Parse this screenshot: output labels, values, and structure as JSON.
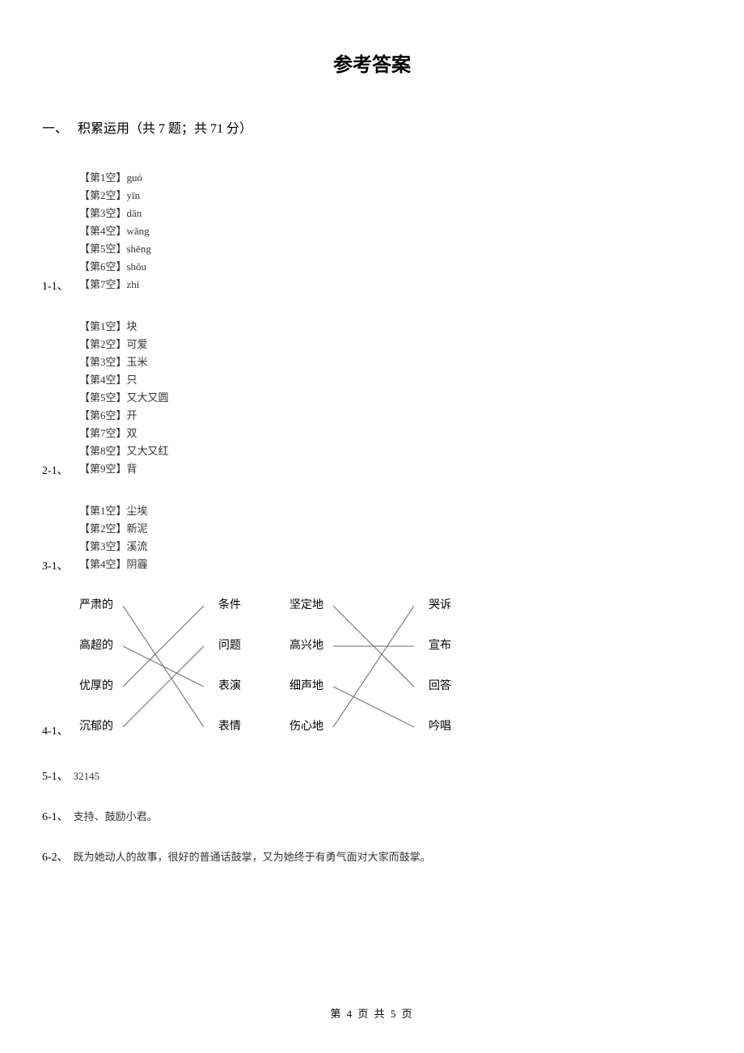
{
  "title": "参考答案",
  "section": {
    "prefix": "一、",
    "label": "积累运用（共 7 题；共 71 分）"
  },
  "q1": {
    "num": "1-1、",
    "items": [
      "【第1空】guó",
      "【第2空】yīn",
      "【第3空】dān",
      "【第4空】wǎng",
      "【第5空】shēng",
      "【第6空】shǒu",
      "【第7空】zhí"
    ]
  },
  "q2": {
    "num": "2-1、",
    "items": [
      "【第1空】块",
      "【第2空】可爱",
      "【第3空】玉米",
      "【第4空】只",
      "【第5空】又大又圆",
      "【第6空】开",
      "【第7空】双",
      "【第8空】又大又红",
      "【第9空】背"
    ]
  },
  "q3": {
    "num": "3-1、",
    "items": [
      "【第1空】尘埃",
      "【第2空】新泥",
      "【第3空】溪流",
      "【第4空】阴霾"
    ]
  },
  "q4": {
    "num": "4-1、",
    "groupA": {
      "left": [
        "严肃的",
        "高超的",
        "优厚的",
        "沉郁的"
      ],
      "right": [
        "条件",
        "问题",
        "表演",
        "表情"
      ]
    },
    "groupB": {
      "left": [
        "坚定地",
        "高兴地",
        "细声地",
        "伤心地"
      ],
      "right": [
        "哭诉",
        "宣布",
        "回答",
        "吟唱"
      ]
    }
  },
  "q5": {
    "num": "5-1、",
    "ans": "32145"
  },
  "q6_1": {
    "num": "6-1、",
    "ans": "支持、鼓励小君。"
  },
  "q6_2": {
    "num": "6-2、",
    "ans": "既为她动人的故事，很好的普通话鼓掌，又为她终于有勇气面对大家而鼓掌。"
  },
  "footer": "第 4 页 共 5 页"
}
